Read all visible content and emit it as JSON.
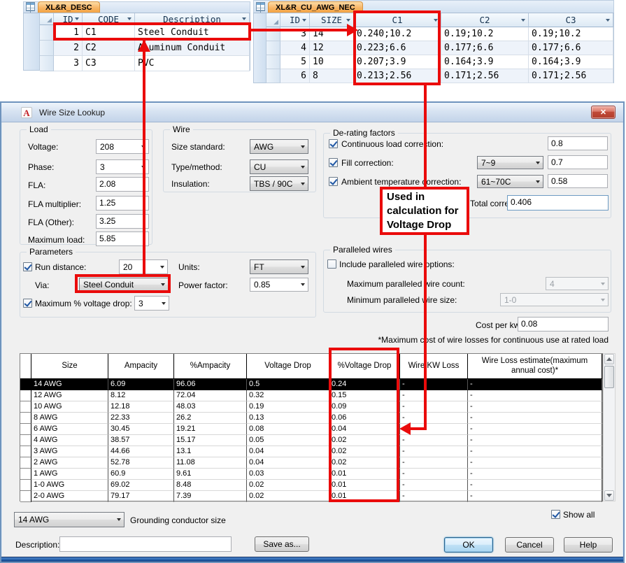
{
  "colors": {
    "annotation_red": "#ea0b0b",
    "tab_orange": "#f5a850",
    "titlebar_blue": "#cfdeef",
    "bottom_bar_blue": "#1d5bac",
    "selection_black": "#000000",
    "ok_default_border_blue": "#2c628b"
  },
  "icons": {
    "close": "✕",
    "app_letter": "A",
    "corner_triangle": "◢"
  },
  "access_left": {
    "tab_label": "XL&R_DESC",
    "columns": [
      "ID",
      "CODE",
      "Description"
    ],
    "rows": [
      [
        "1",
        "C1",
        "Steel Conduit"
      ],
      [
        "2",
        "C2",
        "Aluminum Conduit"
      ],
      [
        "3",
        "C3",
        "PVC"
      ]
    ]
  },
  "access_right": {
    "tab_label": "XL&R_CU_AWG_NEC",
    "columns": [
      "ID",
      "SIZE",
      "C1",
      "C2",
      "C3"
    ],
    "rows": [
      [
        "3",
        "14",
        "0.240;10.2",
        "0.19;10.2",
        "0.19;10.2"
      ],
      [
        "4",
        "12",
        "0.223;6.6",
        "0.177;6.6",
        "0.177;6.6"
      ],
      [
        "5",
        "10",
        "0.207;3.9",
        "0.164;3.9",
        "0.164;3.9"
      ],
      [
        "6",
        "8",
        "0.213;2.56",
        "0.171;2.56",
        "0.171;2.56"
      ]
    ]
  },
  "annotation": {
    "line1": "Used in",
    "line2": "calculation for",
    "line3": "Voltage Drop"
  },
  "dialog": {
    "title": "Wire Size Lookup",
    "load": {
      "caption": "Load",
      "voltage_label": "Voltage:",
      "voltage": "208",
      "phase_label": "Phase:",
      "phase": "3",
      "fla_label": "FLA:",
      "fla": "2.08",
      "fla_mult_label": "FLA multiplier:",
      "fla_mult": "1.25",
      "fla_other_label": "FLA (Other):",
      "fla_other": "3.25",
      "max_load_label": "Maximum load:",
      "max_load": "5.85"
    },
    "wire": {
      "caption": "Wire",
      "size_standard_label": "Size standard:",
      "size_standard": "AWG",
      "type_label": "Type/method:",
      "type": "CU",
      "insulation_label": "Insulation:",
      "insulation": "TBS / 90C"
    },
    "derating": {
      "caption": "De-rating factors",
      "continuous_label": "Continuous load correction:",
      "continuous": "0.8",
      "fill_label": "Fill correction:",
      "fill_range": "7~9",
      "fill": "0.7",
      "ambient_label": "Ambient temperature correction:",
      "ambient_range": "61~70C",
      "ambient": "0.58",
      "total_label": "Total correction:",
      "total": "0.406"
    },
    "parameters": {
      "caption": "Parameters",
      "run_label": "Run distance:",
      "run": "20",
      "units_label": "Units:",
      "units": "FT",
      "via_label": "Via:",
      "via": "Steel Conduit",
      "power_label": "Power factor:",
      "power": "0.85",
      "max_vd_label": "Maximum % voltage drop:",
      "max_vd": "3"
    },
    "paralleled": {
      "caption": "Paralleled wires",
      "include_label": "Include paralleled wire options:",
      "max_count_label": "Maximum paralleled wire count:",
      "max_count": "4",
      "min_size_label": "Minimum paralleled wire size:",
      "min_size": "1-0"
    },
    "cost_label": "Cost per kwh:",
    "cost": "0.08",
    "note": "*Maximum cost of wire losses for continuous use at rated load",
    "grid": {
      "columns": [
        "Size",
        "Ampacity",
        "%Ampacity",
        "Voltage Drop",
        "%Voltage Drop",
        "Wire KW Loss",
        "Wire Loss estimate(maximum annual cost)*"
      ],
      "rows": [
        [
          "14 AWG",
          "6.09",
          "96.06",
          "0.5",
          "0.24",
          "-",
          "-"
        ],
        [
          "12 AWG",
          "8.12",
          "72.04",
          "0.32",
          "0.15",
          "-",
          "-"
        ],
        [
          "10 AWG",
          "12.18",
          "48.03",
          "0.19",
          "0.09",
          "-",
          "-"
        ],
        [
          "8 AWG",
          "22.33",
          "26.2",
          "0.13",
          "0.06",
          "-",
          "-"
        ],
        [
          "6 AWG",
          "30.45",
          "19.21",
          "0.08",
          "0.04",
          "-",
          "-"
        ],
        [
          "4 AWG",
          "38.57",
          "15.17",
          "0.05",
          "0.02",
          "-",
          "-"
        ],
        [
          "3 AWG",
          "44.66",
          "13.1",
          "0.04",
          "0.02",
          "-",
          "-"
        ],
        [
          "2 AWG",
          "52.78",
          "11.08",
          "0.04",
          "0.02",
          "-",
          "-"
        ],
        [
          "1 AWG",
          "60.9",
          "9.61",
          "0.03",
          "0.01",
          "-",
          "-"
        ],
        [
          "1-0 AWG",
          "69.02",
          "8.48",
          "0.02",
          "0.01",
          "-",
          "-"
        ],
        [
          "2-0 AWG",
          "79.17",
          "7.39",
          "0.02",
          "0.01",
          "-",
          "-"
        ]
      ],
      "selected_index": 0
    },
    "grounding": {
      "value": "14 AWG",
      "label": "Grounding conductor size"
    },
    "show_all_label": "Show all",
    "description_label": "Description:",
    "description_value": "",
    "save_as": "Save as...",
    "ok": "OK",
    "cancel": "Cancel",
    "help": "Help"
  }
}
